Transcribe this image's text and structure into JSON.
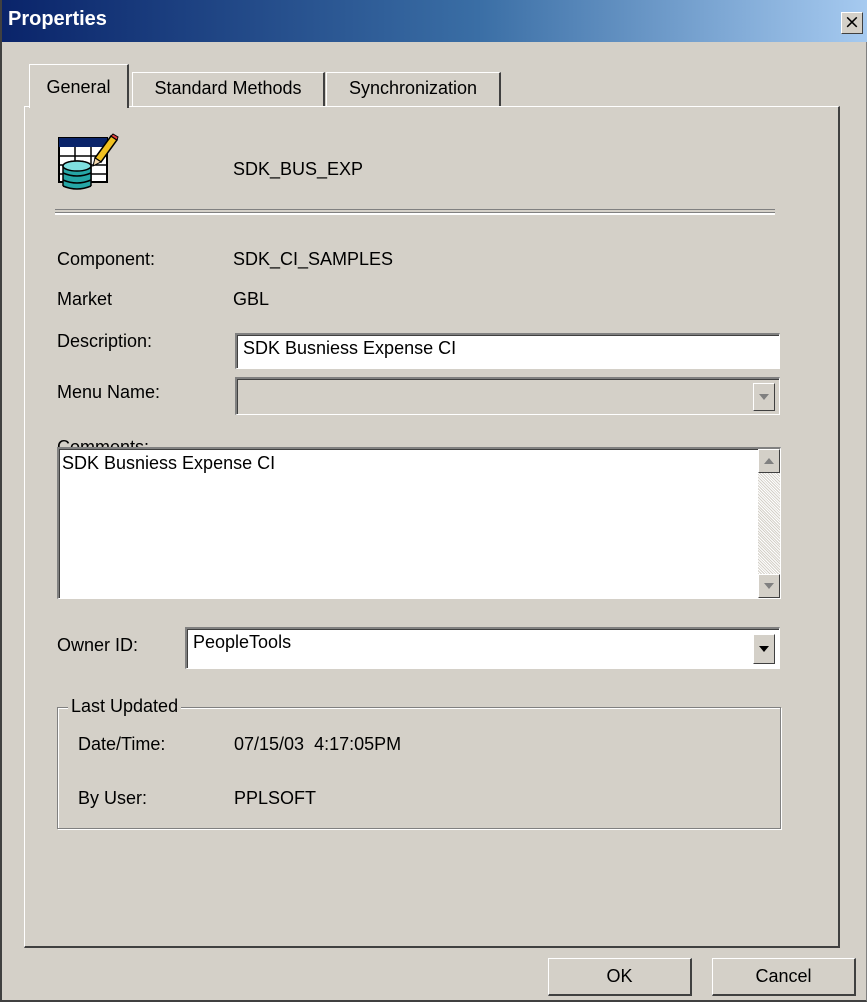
{
  "window": {
    "title": "Properties",
    "close_glyph": "×"
  },
  "tabs": [
    {
      "label": "General",
      "active": true
    },
    {
      "label": "Standard Methods",
      "active": false
    },
    {
      "label": "Synchronization",
      "active": false
    }
  ],
  "general": {
    "icon": "component-interface-icon",
    "name": "SDK_BUS_EXP",
    "component_label": "Component:",
    "component_value": "SDK_CI_SAMPLES",
    "market_label": "Market",
    "market_value": "GBL",
    "description_label": "Description:",
    "description_value": "SDK Busniess Expense CI",
    "menu_name_label": "Menu Name:",
    "menu_name_value": "",
    "comments_label": "Comments:",
    "comments_value": "SDK Busniess Expense CI",
    "owner_label": "Owner ID:",
    "owner_value": "PeopleTools"
  },
  "last_updated": {
    "title": "Last Updated",
    "datetime_label": "Date/Time:",
    "datetime_value": "07/15/03  4:17:05PM",
    "user_label": "By User:",
    "user_value": "PPLSOFT"
  },
  "buttons": {
    "ok": "OK",
    "cancel": "Cancel"
  },
  "colors": {
    "title_start": "#0a246a",
    "title_end": "#a6caf0",
    "face": "#d4d0c8"
  }
}
